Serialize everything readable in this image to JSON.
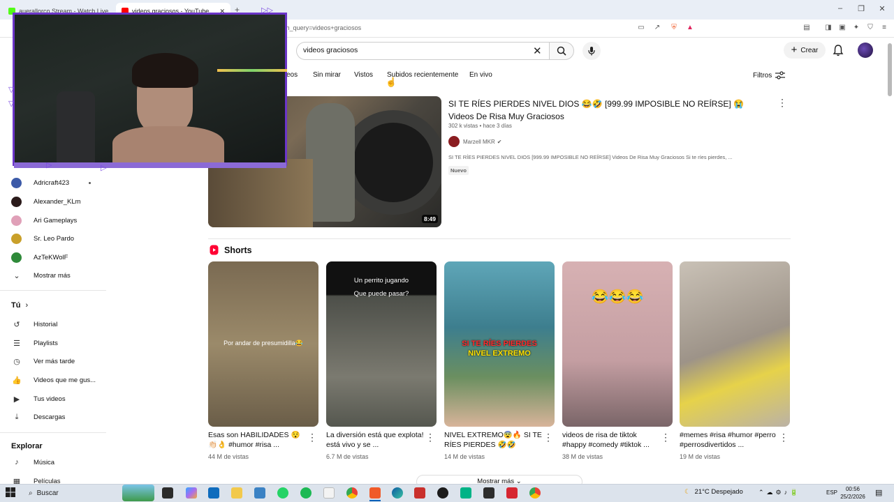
{
  "browser": {
    "tabs": [
      {
        "title": "auerallorco Stream - Watch Live on",
        "fav_color": "#53fc18"
      },
      {
        "title": "videos graciosos - YouTube",
        "fav_color": "#ff0000"
      }
    ],
    "url": "ch_query=videos+graciosos"
  },
  "header": {
    "search_value": "videos graciosos",
    "create_label": "Crear"
  },
  "chips": [
    "eos",
    "Sin mirar",
    "Vistos",
    "Subidos recientemente",
    "En vivo"
  ],
  "filters_label": "Filtros",
  "sidebar": {
    "subscriptions": [
      {
        "label": "Adricraft423",
        "color": "#3c5aa8",
        "new": true
      },
      {
        "label": "Alexander_KLm",
        "color": "#2a1a1a",
        "new": false
      },
      {
        "label": "Ari Gameplays",
        "color": "#e0a0b8",
        "new": false
      },
      {
        "label": "Sr. Leo Pardo",
        "color": "#c9a02a",
        "new": false
      },
      {
        "label": "AzTeKWolF",
        "color": "#2f8a3a",
        "new": false
      }
    ],
    "show_more": "Mostrar más",
    "you_heading": "Tú",
    "you_items": [
      "Historial",
      "Playlists",
      "Ver más tarde",
      "Videos que me gus...",
      "Tus videos",
      "Descargas"
    ],
    "explore_heading": "Explorar",
    "explore_items": [
      "Música",
      "Películas"
    ]
  },
  "main_video": {
    "title": "SI TE RÍES PIERDES NIVEL DIOS 😂🤣 [999.99 IMPOSIBLE NO REÍRSE] 😭 Videos De Risa Muy Graciosos",
    "meta": "302 k vistas • hace 3 días",
    "channel": "Marzell MKR",
    "description": "SI TE RÍES PIERDES NIVEL DIOS [999.99 IMPOSIBLE NO REÍRSE] Videos De Risa Muy Graciosos Si te ríes pierdes, ...",
    "badge": "Nuevo",
    "duration": "8:49"
  },
  "shorts_heading": "Shorts",
  "shorts": [
    {
      "title": "Esas son HABILIDADES 😯👏🏻👌 #humor #risa ...",
      "views": "44 M de vistas",
      "overlay": "Por andar de presumidilla😂",
      "bg": "#8a7a60"
    },
    {
      "title": "La diversión está que explota! está vivo y se ...",
      "views": "6.7 M de vistas",
      "overlay": "Un perrito jugando",
      "overlay2": "Que puede pasar?",
      "bg": "#3a3a38"
    },
    {
      "title": "NIVEL EXTREMO😨🔥 SI TE RÍES PIERDES 🤣🤣 #Shorts",
      "views": "14 M de vistas",
      "overlay": "SI TE RÍES PIERDES",
      "overlay2": "NIVEL EXTREMO",
      "bg": "#4a8fa0"
    },
    {
      "title": "videos de risa de tiktok #happy #comedy #tiktok ...",
      "views": "38 M de vistas",
      "overlay": "😂😂😂",
      "bg": "#c9a6a8"
    },
    {
      "title": "#memes #risa #humor #perro #perrosdivertidos ...",
      "views": "19 M de vistas",
      "overlay": "",
      "bg": "#b8b0a5"
    }
  ],
  "more_label": "Mostrar más",
  "taskbar": {
    "search": "Buscar",
    "weather": "21°C  Despejado",
    "lang": "ESP",
    "time": "00:56",
    "date": "25/2/2026"
  }
}
